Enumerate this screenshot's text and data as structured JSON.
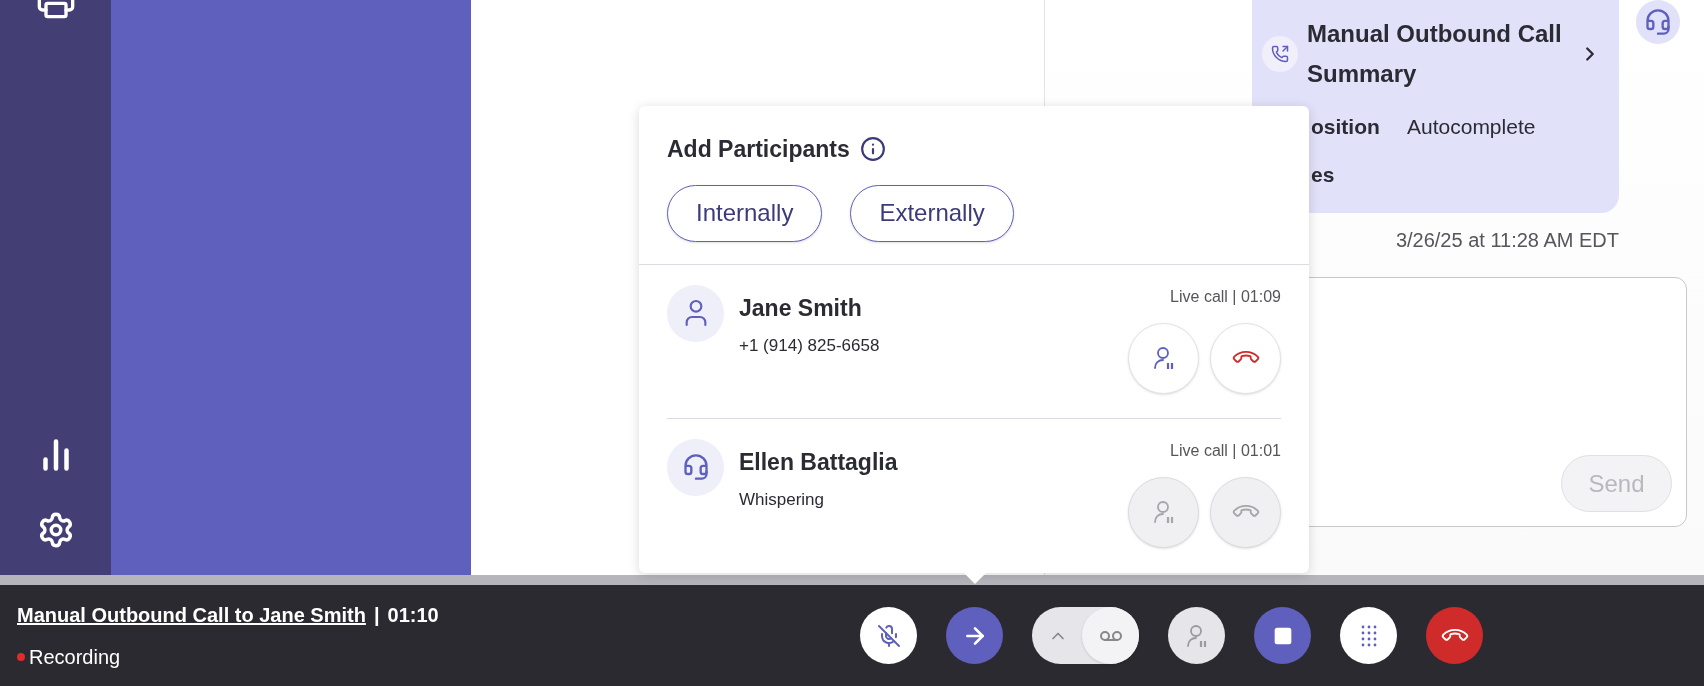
{
  "call_summary": {
    "title": "Manual Outbound Call Summary",
    "fields": [
      {
        "label": "osition",
        "value": "Autocomplete"
      },
      {
        "label": "es"
      }
    ],
    "timestamp": "3/26/25 at 11:28 AM EDT"
  },
  "composer": {
    "send_button": {
      "label": "Send",
      "disabled": true
    }
  },
  "add_participants": {
    "title": "Add Participants",
    "buttons": [
      "Internally",
      "Externally"
    ],
    "participants": [
      {
        "kind": "person",
        "name": "Jane Smith",
        "detail": "+1 (914) 825-6658",
        "status": "Live call | 01:09",
        "disabled": false
      },
      {
        "kind": "agent",
        "name": "Ellen Battaglia",
        "detail": "Whispering",
        "status": "Live call | 01:01",
        "disabled": true
      }
    ]
  },
  "call_bar": {
    "title": "Manual Outbound Call to Jane Smith",
    "separator": "|",
    "timer": "01:10",
    "recording": "Recording",
    "controls": [
      {
        "kind": "mute",
        "disabled": false
      },
      {
        "kind": "add",
        "disabled": false
      },
      {
        "kind": "voicemail",
        "disabled": false
      },
      {
        "kind": "hold",
        "disabled": true
      },
      {
        "kind": "record",
        "disabled": false
      },
      {
        "kind": "dialpad",
        "disabled": false
      },
      {
        "kind": "hangup",
        "disabled": false
      }
    ]
  }
}
